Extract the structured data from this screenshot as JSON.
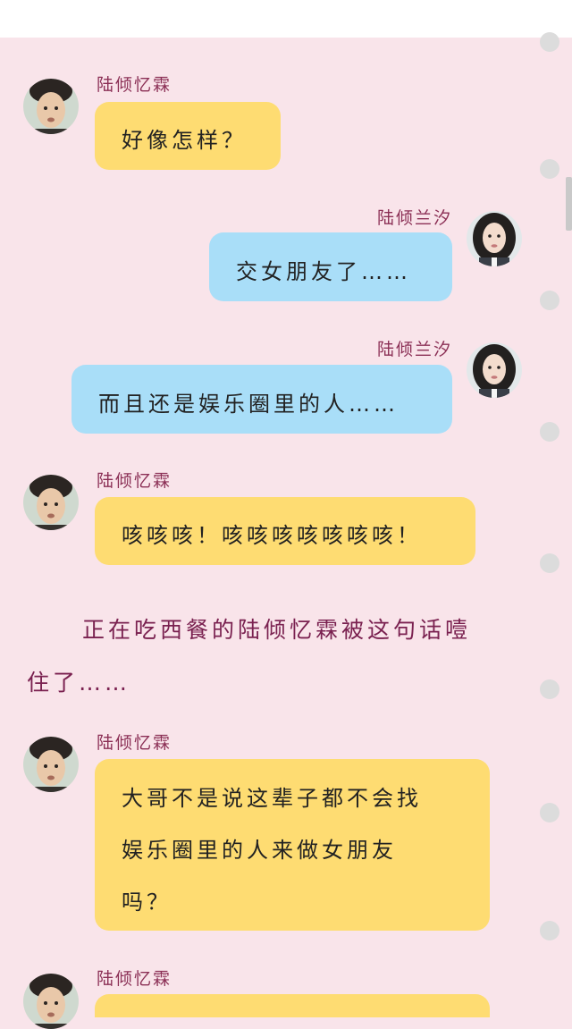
{
  "messages": [
    {
      "sender": "陆倾忆霖",
      "side": "left",
      "avatar": "male-avatar",
      "lines": [
        "好像怎样？"
      ]
    },
    {
      "sender": "陆倾兰汐",
      "side": "right",
      "avatar": "female-avatar",
      "lines": [
        "交女朋友了……"
      ]
    },
    {
      "sender": "陆倾兰汐",
      "side": "right",
      "avatar": "female-avatar",
      "lines": [
        "而且还是娱乐圈里的人……"
      ]
    },
    {
      "sender": "陆倾忆霖",
      "side": "left",
      "avatar": "male-avatar",
      "lines": [
        "咳咳咳！咳咳咳咳咳咳咳！"
      ]
    },
    {
      "sender": "陆倾忆霖",
      "side": "left",
      "avatar": "male-avatar",
      "lines": [
        "大哥不是说这辈子都不会找",
        "娱乐圈里的人来做女朋友",
        "吗？"
      ]
    },
    {
      "sender": "陆倾忆霖",
      "side": "left",
      "avatar": "male-avatar",
      "lines": []
    }
  ],
  "narration": {
    "line1": "正在吃西餐的陆倾忆霖被这句话噎",
    "line2": "住了……"
  },
  "colors": {
    "background": "#f9e4ea",
    "bubble_left": "#fedc72",
    "bubble_right": "#a9def8",
    "sender_name": "#8b2f55",
    "narration": "#7a2150"
  }
}
